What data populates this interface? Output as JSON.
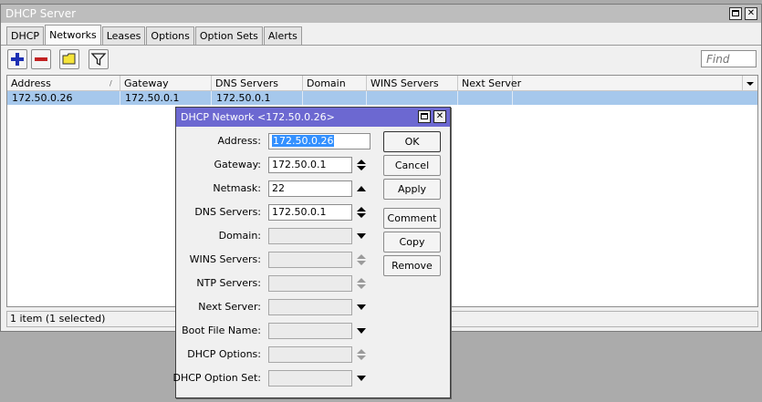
{
  "main_window": {
    "title": "DHCP Server",
    "tabs": [
      "DHCP",
      "Networks",
      "Leases",
      "Options",
      "Option Sets",
      "Alerts"
    ],
    "active_tab": "Networks",
    "find_placeholder": "Find",
    "columns": [
      "Address",
      "Gateway",
      "DNS Servers",
      "Domain",
      "WINS Servers",
      "Next Server"
    ],
    "rows": [
      {
        "address": "172.50.0.26",
        "gateway": "172.50.0.1",
        "dns": "172.50.0.1",
        "domain": "",
        "wins": "",
        "next_server": ""
      }
    ],
    "status": "1 item (1 selected)"
  },
  "toolbar_icons": [
    "add-icon",
    "remove-icon",
    "comment-icon",
    "filter-icon"
  ],
  "dialog": {
    "title": "DHCP Network <172.50.0.26>",
    "fields": {
      "address_label": "Address:",
      "address_value": "172.50.0.26",
      "gateway_label": "Gateway:",
      "gateway_value": "172.50.0.1",
      "netmask_label": "Netmask:",
      "netmask_value": "22",
      "dns_label": "DNS Servers:",
      "dns_value": "172.50.0.1",
      "domain_label": "Domain:",
      "wins_label": "WINS Servers:",
      "ntp_label": "NTP Servers:",
      "next_server_label": "Next Server:",
      "boot_file_label": "Boot File Name:",
      "dhcp_options_label": "DHCP Options:",
      "dhcp_option_set_label": "DHCP Option Set:"
    },
    "buttons": {
      "ok": "OK",
      "cancel": "Cancel",
      "apply": "Apply",
      "comment": "Comment",
      "copy": "Copy",
      "remove": "Remove"
    }
  },
  "colors": {
    "selection": "#a6c8ec",
    "dialog_title": "#6c68d1",
    "window_title": "#bdbdbd",
    "add": "#1c2fb3",
    "remove": "#c22121",
    "comment": "#f5e43a"
  }
}
